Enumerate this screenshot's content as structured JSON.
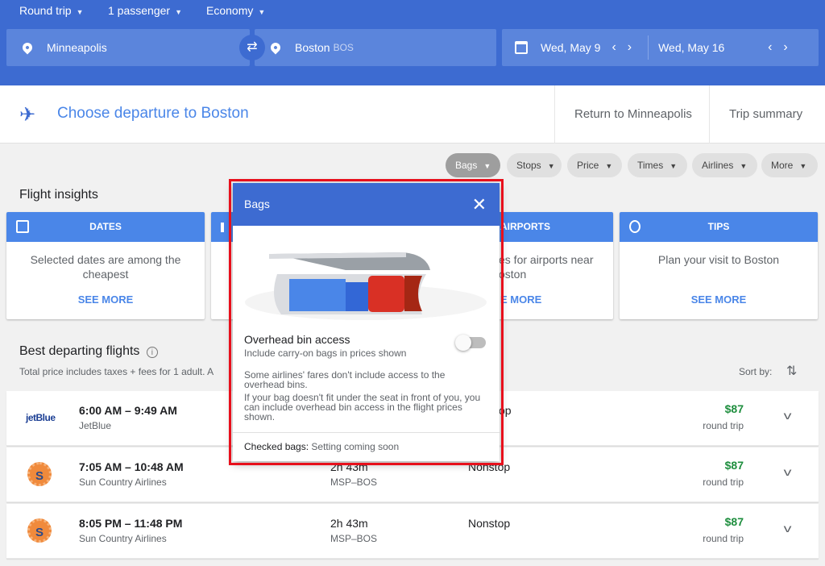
{
  "search": {
    "trip_type": "Round trip",
    "passengers": "1 passenger",
    "cabin": "Economy",
    "origin": "Minneapolis",
    "destination": "Boston",
    "destination_code": "BOS",
    "depart_date": "Wed, May 9",
    "return_date": "Wed, May 16"
  },
  "steps": {
    "current": "Choose departure to Boston",
    "return": "Return to Minneapolis",
    "summary": "Trip summary"
  },
  "filters": [
    {
      "label": "Bags",
      "active": true
    },
    {
      "label": "Stops"
    },
    {
      "label": "Price"
    },
    {
      "label": "Times"
    },
    {
      "label": "Airlines"
    },
    {
      "label": "More"
    }
  ],
  "insights": {
    "title": "Flight insights",
    "cards": [
      {
        "label": "DATES",
        "icon": "calendar-icon",
        "text": "Selected dates are among the cheapest",
        "link": "SEE MORE"
      },
      {
        "label": "",
        "icon": "bar-chart-icon",
        "text": "",
        "link": ""
      },
      {
        "label": "AIRPORTS",
        "text_line1": "es for airports near",
        "text_line2": "oston",
        "link": "E MORE"
      },
      {
        "label": "TIPS",
        "icon": "lightbulb-icon",
        "text": "Plan your visit to Boston",
        "link": "SEE MORE"
      }
    ]
  },
  "results": {
    "title": "Best departing flights",
    "subtitle": "Total price includes taxes + fees for 1 adult. A",
    "sort_label": "Sort by:",
    "flights": [
      {
        "times": "6:00 AM – 9:49 AM",
        "airline": "JetBlue",
        "logo": "jetBlue",
        "duration": "",
        "route": "",
        "stops": "op",
        "price": "$87",
        "price_label": "round trip"
      },
      {
        "times": "7:05 AM – 10:48 AM",
        "airline": "Sun Country Airlines",
        "logo": "S",
        "duration": "2h 43m",
        "route": "MSP–BOS",
        "stops": "Nonstop",
        "price": "$87",
        "price_label": "round trip"
      },
      {
        "times": "8:05 PM – 11:48 PM",
        "airline": "Sun Country Airlines",
        "logo": "S",
        "duration": "2h 43m",
        "route": "MSP–BOS",
        "stops": "Nonstop",
        "price": "$87",
        "price_label": "round trip"
      }
    ]
  },
  "bags_popup": {
    "title": "Bags",
    "toggle_label": "Overhead bin access",
    "toggle_sub": "Include carry-on bags in prices shown",
    "toggle_on": false,
    "info1": "Some airlines' fares don't include access to the overhead bins.",
    "info2": "If your bag doesn't fit under the seat in front of you, you can include overhead bin access in the flight prices shown.",
    "checked_label": "Checked bags:",
    "checked_value": "Setting coming soon"
  },
  "colors": {
    "header": "#3d6bd1",
    "accent": "#4a86e8",
    "price": "#1e8e3e",
    "highlight": "#e8101c"
  }
}
